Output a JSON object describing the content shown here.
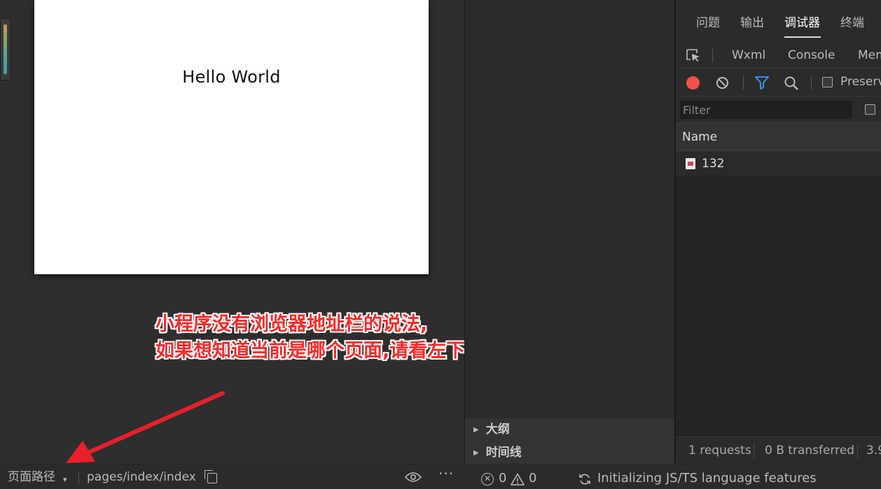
{
  "simulator": {
    "hello_text": "Hello World",
    "annotation_line1": "小程序没有浏览器地址栏的说法,",
    "annotation_line2": "如果想知道当前是哪个页面,请看左下角的页面路径",
    "annotation_color": "#ff2a2a",
    "footer": {
      "page_path_label": "页面路径",
      "caret": "▾",
      "page_path_value": "pages/index/index",
      "more": "···"
    }
  },
  "middle_panel": {
    "outline_label": "大纲",
    "timeline_label": "时间线"
  },
  "devtools": {
    "top_tabs": [
      {
        "label": "问题"
      },
      {
        "label": "输出"
      },
      {
        "label": "调试器",
        "active": true
      },
      {
        "label": "终端"
      }
    ],
    "sub_tabs": [
      {
        "label": "Wxml"
      },
      {
        "label": "Console"
      },
      {
        "label": "Mem"
      }
    ],
    "preserve_label": "Preserve",
    "filter_placeholder": "Filter",
    "column_name": "Name",
    "requests": [
      {
        "name": "132"
      }
    ],
    "status": {
      "requests": "1 requests",
      "transferred": "0 B transferred",
      "size": "3.9"
    },
    "record_color": "#f2504b",
    "filter_color": "#3b8fe0"
  },
  "status_bar": {
    "errors": "0",
    "warnings": "0",
    "message": "Initializing JS/TS language features"
  }
}
